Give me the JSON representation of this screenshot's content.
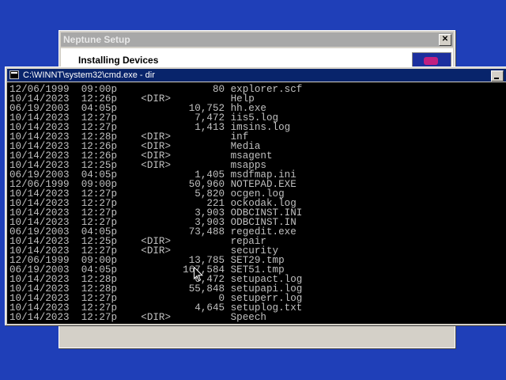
{
  "setup_window": {
    "title": "Neptune Setup",
    "close_label": "✕",
    "heading": "Installing Devices"
  },
  "cmd_window": {
    "title": "C:\\WINNT\\system32\\cmd.exe - dir",
    "icon": "console-icon",
    "lines": [
      "12/06/1999  09:00p                80 explorer.scf",
      "10/14/2023  12:26p    <DIR>          Help",
      "06/19/2003  04:05p            10,752 hh.exe",
      "10/14/2023  12:27p             7,472 iis5.log",
      "10/14/2023  12:27p             1,413 imsins.log",
      "10/14/2023  12:28p    <DIR>          inf",
      "10/14/2023  12:26p    <DIR>          Media",
      "10/14/2023  12:26p    <DIR>          msagent",
      "10/14/2023  12:25p    <DIR>          msapps",
      "06/19/2003  04:05p             1,405 msdfmap.ini",
      "12/06/1999  09:00p            50,960 NOTEPAD.EXE",
      "10/14/2023  12:27p             5,820 ocgen.log",
      "10/14/2023  12:27p               221 ockodak.log",
      "10/14/2023  12:27p             3,903 ODBCINST.INI",
      "10/14/2023  12:27p             3,903 ODBCINST.IN",
      "06/19/2003  04:05p            73,488 regedit.exe",
      "10/14/2023  12:25p    <DIR>          repair",
      "10/14/2023  12:27p    <DIR>          security",
      "12/06/1999  09:00p            13,785 SET29.tmp",
      "06/19/2003  04:05p           167,584 SET51.tmp",
      "10/14/2023  12:28p             6,472 setupact.log",
      "10/14/2023  12:28p            55,848 setupapi.log",
      "10/14/2023  12:27p                 0 setuperr.log",
      "10/14/2023  12:27p             4,645 setuplog.txt",
      "10/14/2023  12:27p    <DIR>          Speech"
    ]
  },
  "colors": {
    "desktop": "#1f3fb8",
    "console_bg": "#000000",
    "console_text": "#c0c0c0",
    "active_title": "#08246b",
    "inactive_title": "#a8a8a8"
  }
}
